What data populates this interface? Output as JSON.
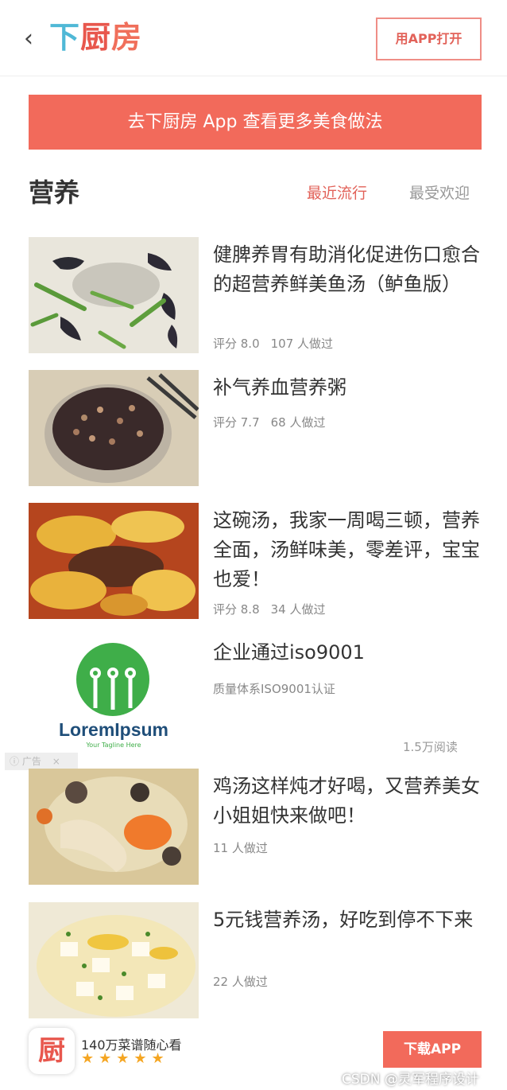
{
  "header": {
    "back_icon": "chevron-left-icon",
    "logo": {
      "c1": "下",
      "c2": "厨",
      "c3": "房"
    },
    "open_app_label": "用APP打开"
  },
  "banner": {
    "text": "去下厨房 App 查看更多美食做法"
  },
  "section": {
    "title": "营养",
    "tabs": [
      {
        "label": "最近流行",
        "active": true
      },
      {
        "label": "最受欢迎",
        "active": false
      }
    ]
  },
  "recipes": [
    {
      "title": "健脾养胃有助消化促进伤口愈合的超营养鲜美鱼汤（鲈鱼版）",
      "score": "评分 8.0",
      "cooked": "107 人做过"
    },
    {
      "title": "补气养血营养粥",
      "score": "评分 7.7",
      "cooked": "68 人做过"
    },
    {
      "title": "这碗汤，我家一周喝三顿，营养全面，汤鲜味美，零差评，宝宝也爱！",
      "score": "评分 8.8",
      "cooked": "34 人做过"
    }
  ],
  "ad": {
    "title": "企业通过iso9001",
    "desc": "质量体系ISO9001认证",
    "logo_text": "LoremIpsum",
    "logo_tagline": "Your Tagline Here",
    "reads": "1.5万阅读",
    "tag": "广告"
  },
  "recipes2": [
    {
      "title": "鸡汤这样炖才好喝，又营养美女小姐姐快来做吧！",
      "cooked": "11 人做过"
    },
    {
      "title": "5元钱营养汤，好吃到停不下来",
      "cooked": "22 人做过"
    }
  ],
  "bottom": {
    "app_icon_char": "厨",
    "tagline": "140万菜谱随心看",
    "stars": "★★★★★",
    "download_label": "下载APP",
    "watermark": "CSDN @灵军程序设计"
  },
  "colors": {
    "accent": "#f26a5b",
    "logo_blue": "#4fb8d6",
    "star": "#f5a623"
  }
}
